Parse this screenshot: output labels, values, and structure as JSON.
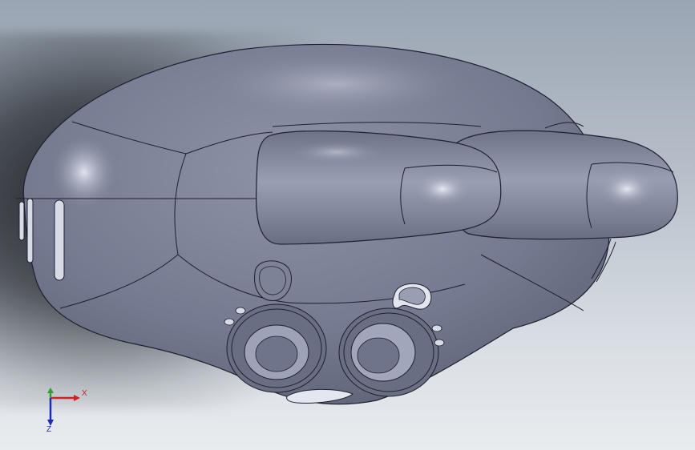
{
  "viewport": {
    "background_top": "#9aa5b3",
    "background_bottom": "#e9ecef"
  },
  "model": {
    "body_color": "#767a90",
    "edge_color": "#1e2030",
    "highlight_color": "#e6e8f2"
  },
  "triad": {
    "x_label": "X",
    "z_label": "Z",
    "x_color": "#d32020",
    "y_color": "#2fa02f",
    "z_color": "#1f2bb8"
  }
}
